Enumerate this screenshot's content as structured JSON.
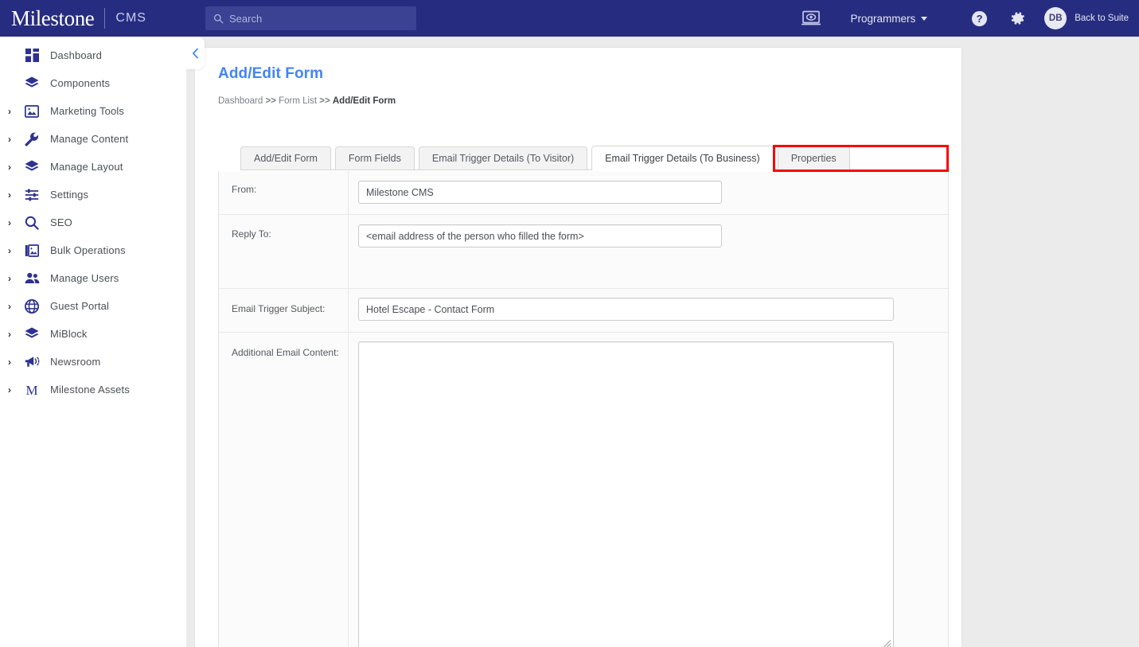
{
  "header": {
    "brand_name": "Milestone",
    "brand_suffix": "CMS",
    "search_placeholder": "Search",
    "account_label": "Programmers",
    "avatar_initials": "DB",
    "back_to_suite": "Back to Suite",
    "icons": {
      "search": "search-icon",
      "preview": "preview-monitor-icon",
      "help": "help-circle-icon",
      "settings": "gear-icon"
    },
    "colors": {
      "bar_background": "#262d80",
      "search_background": "#3b4193"
    }
  },
  "sidebar": {
    "collapse_label": "‹",
    "items": [
      {
        "label": "Dashboard",
        "icon": "dashboard-grid-icon",
        "expandable": false
      },
      {
        "label": "Components",
        "icon": "layers-icon",
        "expandable": false
      },
      {
        "label": "Marketing Tools",
        "icon": "image-icon",
        "expandable": true
      },
      {
        "label": "Manage Content",
        "icon": "wrench-icon",
        "expandable": true
      },
      {
        "label": "Manage Layout",
        "icon": "layers-icon",
        "expandable": true
      },
      {
        "label": "Settings",
        "icon": "sliders-icon",
        "expandable": true
      },
      {
        "label": "SEO",
        "icon": "magnifier-icon",
        "expandable": true
      },
      {
        "label": "Bulk Operations",
        "icon": "gallery-icon",
        "expandable": true
      },
      {
        "label": "Manage Users",
        "icon": "users-icon",
        "expandable": true
      },
      {
        "label": "Guest Portal",
        "icon": "globe-icon",
        "expandable": true
      },
      {
        "label": "MiBlock",
        "icon": "layers-icon",
        "expandable": true
      },
      {
        "label": "Newsroom",
        "icon": "megaphone-icon",
        "expandable": true
      },
      {
        "label": "Milestone Assets",
        "icon": "letter-m-icon",
        "expandable": true
      }
    ]
  },
  "main": {
    "page_title": "Add/Edit Form",
    "breadcrumb": {
      "items": [
        "Dashboard",
        "Form List",
        "Add/Edit Form"
      ],
      "separator": ">>"
    },
    "tabs": [
      {
        "label": "Add/Edit Form",
        "active": false
      },
      {
        "label": "Form Fields",
        "active": false
      },
      {
        "label": "Email Trigger Details (To Visitor)",
        "active": false
      },
      {
        "label": "Email Trigger Details (To Business)",
        "active": true
      },
      {
        "label": "Properties",
        "active": false
      }
    ],
    "highlight_color": "#fb0007",
    "form": {
      "rows": [
        {
          "label": "From:",
          "value": "Milestone CMS",
          "type": "text"
        },
        {
          "label": "Reply To:",
          "value": "<email address of the person who filled the form>",
          "type": "text"
        },
        {
          "label": "Email Trigger Subject:",
          "value": "Hotel Escape - Contact Form",
          "type": "text"
        },
        {
          "label": "Additional Email Content:",
          "value": "",
          "type": "textarea"
        }
      ]
    }
  }
}
